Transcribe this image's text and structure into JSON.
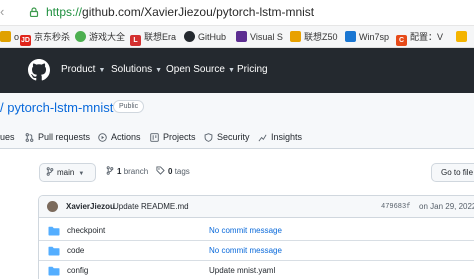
{
  "browser": {
    "url_scheme": "https://",
    "url_host": "github.com",
    "url_path": "/XavierJiezou/pytorch-lstm-mnist",
    "bookmarks": [
      {
        "label": "o",
        "icon": "bookmark-folder-icon",
        "color": "#e0a100"
      },
      {
        "label": "京东秒杀",
        "icon": "jd-logo-icon",
        "color": "#e1251b"
      },
      {
        "label": "游戏大全",
        "icon": "games-icon",
        "color": "#4caf50"
      },
      {
        "label": "联想Era",
        "icon": "lenovo-icon",
        "color": "#d32f2f"
      },
      {
        "label": "GitHub",
        "icon": "github-icon",
        "color": "#24292f"
      },
      {
        "label": "Visual S",
        "icon": "visual-studio-icon",
        "color": "#5c2d91"
      },
      {
        "label": "联想Z50",
        "icon": "lenovo-icon",
        "color": "#e8a100"
      },
      {
        "label": "Win7sp",
        "icon": "windows-icon",
        "color": "#1976d2"
      },
      {
        "label": "配置：V",
        "icon": "config-icon",
        "color": "#e64a19"
      }
    ]
  },
  "github": {
    "nav": [
      "Product",
      "Solutions",
      "Open Source",
      "Pricing"
    ]
  },
  "repo": {
    "title": "/ pytorch-lstm-mnist",
    "visibility": "Public",
    "tabs": [
      {
        "label": "ues",
        "icon": "issues-icon"
      },
      {
        "label": "Pull requests",
        "icon": "pull-request-icon"
      },
      {
        "label": "Actions",
        "icon": "actions-icon"
      },
      {
        "label": "Projects",
        "icon": "projects-icon"
      },
      {
        "label": "Security",
        "icon": "security-icon"
      },
      {
        "label": "Insights",
        "icon": "insights-icon"
      }
    ],
    "branch": "main",
    "branch_count": "1",
    "branch_label": "branch",
    "tag_count": "0",
    "tag_label": "tags",
    "goto_file": "Go to file",
    "last_commit": {
      "author": "XavierJiezou",
      "message": "Update README.md",
      "sha": "479683f",
      "date": "on Jan 29, 2022"
    },
    "files": [
      {
        "name": "checkpoint",
        "message": "No commit message",
        "link": true
      },
      {
        "name": "code",
        "message": "No commit message",
        "link": true
      },
      {
        "name": "config",
        "message": "Update mnist.yaml",
        "link": false
      }
    ]
  }
}
